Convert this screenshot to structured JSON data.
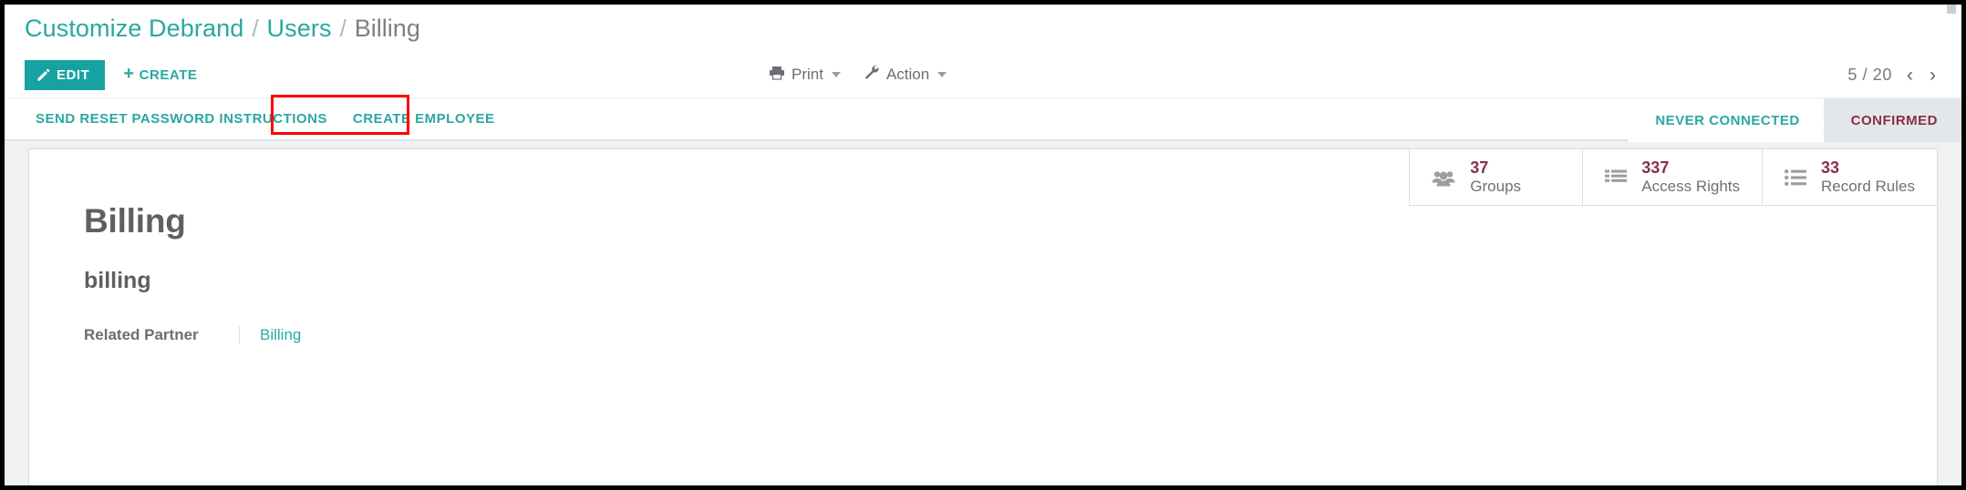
{
  "breadcrumb": {
    "items": [
      {
        "label": "Customize Debrand",
        "current": false
      },
      {
        "label": "Users",
        "current": false
      },
      {
        "label": "Billing",
        "current": true
      }
    ],
    "separator": "/"
  },
  "control_panel": {
    "edit_label": "EDIT",
    "create_label": "CREATE",
    "create_plus": "+",
    "print_label": "Print",
    "action_label": "Action",
    "pager": {
      "value": "5 / 20",
      "prev": "‹",
      "next": "›"
    }
  },
  "object_buttons": {
    "send_reset_password": "SEND RESET PASSWORD INSTRUCTIONS",
    "create_employee": "CREATE EMPLOYEE"
  },
  "statusbar": {
    "stages": [
      {
        "label": "NEVER CONNECTED",
        "active": false
      },
      {
        "label": "CONFIRMED",
        "active": true
      }
    ]
  },
  "stat_buttons": [
    {
      "value": "37",
      "label": "Groups",
      "icon": "users-icon"
    },
    {
      "value": "337",
      "label": "Access Rights",
      "icon": "list-icon"
    },
    {
      "value": "33",
      "label": "Record Rules",
      "icon": "list-bullet-icon"
    }
  ],
  "record": {
    "title": "Billing",
    "subtitle": "billing",
    "fields": [
      {
        "label": "Related Partner",
        "value": "Billing"
      }
    ]
  },
  "colors": {
    "accent_teal": "#2aa8a0",
    "edit_button": "#17a2a2",
    "status_active": "#8a2e48",
    "highlight": "#ff0000",
    "text_gray": "#5d6063"
  }
}
